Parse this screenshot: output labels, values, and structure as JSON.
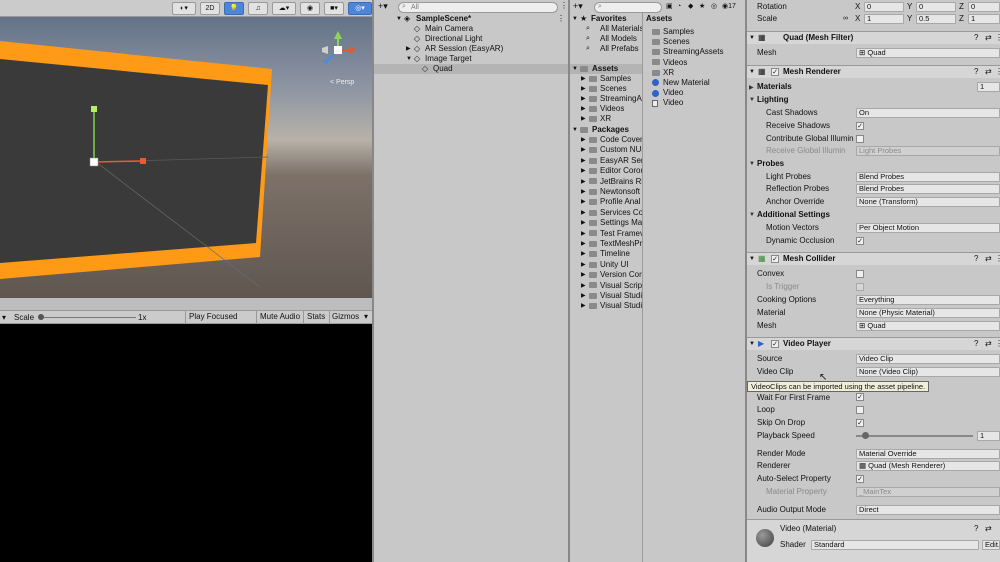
{
  "scene": {
    "toolbar": {
      "mode_2d": "2D"
    },
    "gizmo_label": "< Persp"
  },
  "game_toolbar": {
    "scale_label": "Scale",
    "scale_value": "1x",
    "play_focused": "Play Focused",
    "mute_audio": "Mute Audio",
    "stats": "Stats",
    "gizmos": "Gizmos"
  },
  "hierarchy": {
    "search_placeholder": "All",
    "items": [
      {
        "label": "SampleScene*"
      },
      {
        "label": "Main Camera"
      },
      {
        "label": "Directional Light"
      },
      {
        "label": "AR Session (EasyAR)"
      },
      {
        "label": "Image Target"
      },
      {
        "label": "Quad"
      }
    ]
  },
  "project": {
    "count": "17",
    "favorites_label": "Favorites",
    "favorites": [
      "All Materials",
      "All Models",
      "All Prefabs"
    ],
    "assets_label": "Assets",
    "assets_tree": [
      "Samples",
      "Scenes",
      "StreamingA",
      "Videos",
      "XR"
    ],
    "packages_label": "Packages",
    "packages": [
      "Code Cover",
      "Custom NUn",
      "EasyAR Ser",
      "Editor Corou",
      "JetBrains Ri",
      "Newtonsoft",
      "Profile Anal",
      "Services Co",
      "Settings Ma",
      "Test Framev",
      "TextMeshPr",
      "Timeline",
      "Unity UI",
      "Version Cor",
      "Visual Scrip",
      "Visual Studi",
      "Visual Studi"
    ],
    "right_header": "Assets",
    "right_items": [
      {
        "label": "Samples",
        "kind": "folder"
      },
      {
        "label": "Scenes",
        "kind": "folder"
      },
      {
        "label": "StreamingAssets",
        "kind": "folder"
      },
      {
        "label": "Videos",
        "kind": "folder"
      },
      {
        "label": "XR",
        "kind": "folder"
      },
      {
        "label": "New Material",
        "kind": "material"
      },
      {
        "label": "Video",
        "kind": "material"
      },
      {
        "label": "Video",
        "kind": "file"
      }
    ]
  },
  "inspector": {
    "transform": {
      "rotation_label": "Rotation",
      "scale_label": "Scale",
      "rot": {
        "x": "0",
        "y": "0",
        "z": "0"
      },
      "scale": {
        "x": "1",
        "y": "0.5",
        "z": "1"
      },
      "axis_x": "X",
      "axis_y": "Y",
      "axis_z": "Z"
    },
    "mesh_filter": {
      "title": "Quad (Mesh Filter)",
      "mesh_label": "Mesh",
      "mesh_value": "Quad"
    },
    "mesh_renderer": {
      "title": "Mesh Renderer",
      "materials_label": "Materials",
      "materials_count": "1",
      "lighting_label": "Lighting",
      "cast_shadows_label": "Cast Shadows",
      "cast_shadows_value": "On",
      "receive_shadows_label": "Receive Shadows",
      "contribute_gi_label": "Contribute Global Illumin",
      "receive_gi_label": "Receive Global Illumin",
      "receive_gi_value": "Light Probes",
      "probes_label": "Probes",
      "light_probes_label": "Light Probes",
      "light_probes_value": "Blend Probes",
      "reflection_probes_label": "Reflection Probes",
      "reflection_probes_value": "Blend Probes",
      "anchor_override_label": "Anchor Override",
      "anchor_override_value": "None (Transform)",
      "additional_label": "Additional Settings",
      "motion_vectors_label": "Motion Vectors",
      "motion_vectors_value": "Per Object Motion",
      "dynamic_occlusion_label": "Dynamic Occlusion"
    },
    "mesh_collider": {
      "title": "Mesh Collider",
      "convex_label": "Convex",
      "is_trigger_label": "Is Trigger",
      "cooking_label": "Cooking Options",
      "cooking_value": "Everything",
      "material_label": "Material",
      "material_value": "None (Physic Material)",
      "mesh_label": "Mesh",
      "mesh_value": "Quad"
    },
    "video_player": {
      "title": "Video Player",
      "source_label": "Source",
      "source_value": "Video Clip",
      "clip_label": "Video Clip",
      "clip_value": "None (Video Clip)",
      "tooltip": "VideoClips can be imported using the asset pipeline.",
      "wait_label": "Wait For First Frame",
      "loop_label": "Loop",
      "skip_label": "Skip On Drop",
      "speed_label": "Playback Speed",
      "speed_value": "1",
      "speed_fraction": 0.08,
      "render_mode_label": "Render Mode",
      "render_mode_value": "Material Override",
      "renderer_label": "Renderer",
      "renderer_value": "Quad (Mesh Renderer)",
      "auto_select_label": "Auto-Select Property",
      "material_property_label": "Material Property",
      "material_property_value": "_MainTex",
      "audio_output_label": "Audio Output Mode",
      "audio_output_value": "Direct"
    },
    "material": {
      "title": "Video (Material)",
      "shader_label": "Shader",
      "shader_value": "Standard",
      "edit_label": "Edit..."
    }
  },
  "colors": {
    "accent": "#4d86d8",
    "quad_border": "#ff9a17",
    "quad_face": "#3a3a3a"
  }
}
